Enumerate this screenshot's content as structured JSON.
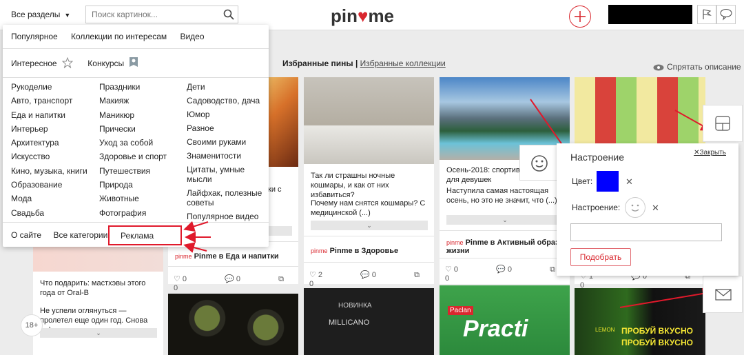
{
  "header": {
    "all_sections": "Все разделы",
    "search_placeholder": "Поиск картинок...",
    "logo_left": "pin",
    "logo_heart": "♥",
    "logo_right": "me"
  },
  "section": {
    "favorite_pins": "Избранные пины",
    "divider": "|",
    "favorite_collections": "Избранные коллекции",
    "hide_description": "Спрятать описание"
  },
  "menu": {
    "top": [
      "Популярное",
      "Коллекции по интересам",
      "Видео"
    ],
    "interesting": "Интересное",
    "contests": "Конкурсы",
    "col1": [
      "Рукоделие",
      "Авто, транспорт",
      "Еда и напитки",
      "Интерьер",
      "Архитектура",
      "Искусство",
      "Кино, музыка, книги",
      "Образование",
      "Мода",
      "Свадьба"
    ],
    "col2": [
      "Праздники",
      "Макияж",
      "Маникюр",
      "Прически",
      "Уход за собой",
      "Здоровье и спорт",
      "Путешествия",
      "Природа",
      "Животные",
      "Фотография"
    ],
    "col3": [
      "Дети",
      "Садоводство, дача",
      "Юмор",
      "Разное",
      "Своими руками",
      "Знаменитости",
      "Цитаты, умные мысли",
      "Лайфхак, полезные советы",
      "Популярное видео"
    ],
    "footer": [
      "О сайте",
      "Все категории"
    ],
    "ad": "Реклама"
  },
  "cards": {
    "c1_text": "Так ли страшны ночные кошмары, и как от них избавиться?",
    "c1_text2": "Почему нам снятся кошмары? С медицинской (...)",
    "c1_author_prefix": "Pinme в ",
    "c1_author": "Здоровье",
    "c1_stats": [
      "2",
      "0",
      "0"
    ],
    "c2_text": "Осень-2018: спортивные образы для девушек",
    "c2_text2": "Наступила самая настоящая осень, но это не значит, что (...)",
    "c2_author_prefix": "Pinme в ",
    "c2_author": "Активный образ жизни",
    "c2_stats": [
      "0",
      "0",
      "0"
    ],
    "c3_author_prefix": "Pinme в ",
    "c3_author": "Еда и напитки",
    "c3_stats": [
      "0",
      "0",
      "0"
    ],
    "c3_partial": "ки с",
    "c4_text": "Что подарить: мастхэвы этого года от Oral-B",
    "c4_text2": "Не успели оглянуться — пролетел еще один год. Снова (...)",
    "c5_stats": [
      "1",
      "0",
      "0"
    ],
    "more_glyph": "⌄",
    "brand_pinme": "pinme"
  },
  "mood_panel": {
    "title": "Настроение",
    "close": "Закрыть",
    "color_label": "Цвет:",
    "color_value": "#0000ff",
    "mood_label": "Настроение:",
    "pick_button": "Подобрать"
  },
  "age": "18+",
  "image_text": {
    "practi": "Practi",
    "paclan": "Paclan",
    "milicano": "MILLICANO",
    "novinka": "НОВИНКА",
    "probuy": "ПРОБУЙ ВКУСНО",
    "lemon": "LEMON"
  },
  "colors": {
    "accent": "#d9272e",
    "highlight": "#e0192b"
  }
}
